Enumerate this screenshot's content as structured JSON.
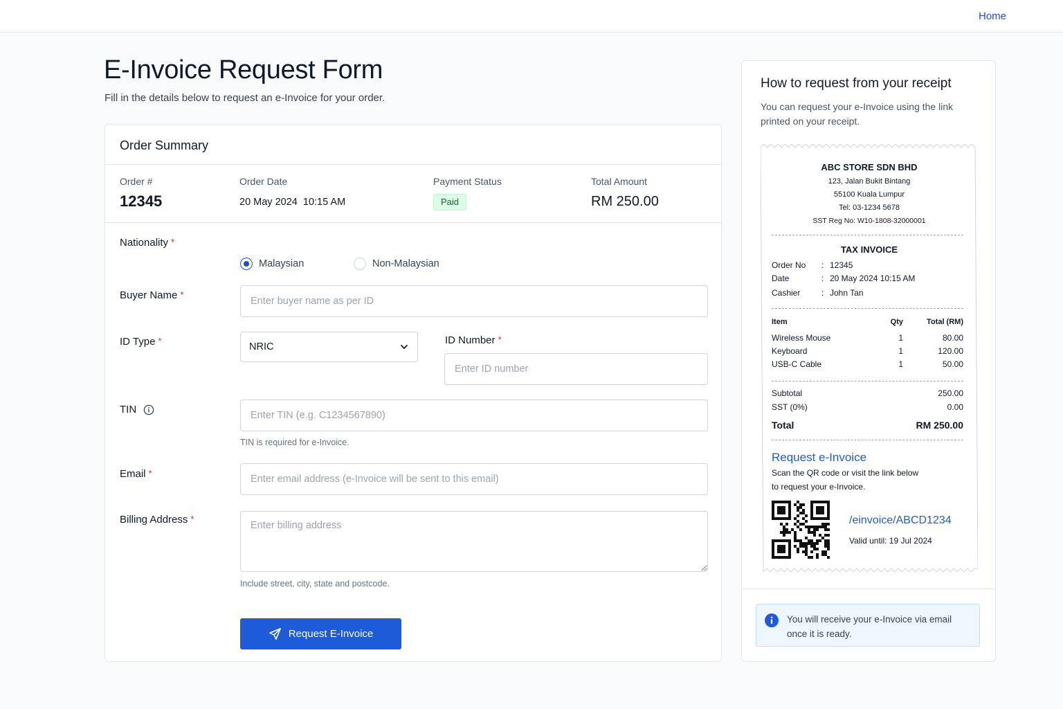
{
  "nav": {
    "home": "Home"
  },
  "page": {
    "title": "E-Invoice Request Form",
    "subtitle": "Fill in the details below to request an e-Invoice for your order."
  },
  "summary": {
    "title": "Order Summary",
    "order_label": "Order #",
    "order_value": "12345",
    "date_label": "Order Date",
    "date_value": "20 May 2024  10:15 AM",
    "status_label": "Payment Status",
    "status_value": "Paid",
    "total_label": "Total Amount",
    "total_value": "RM 250.00"
  },
  "form": {
    "nationality_label": "Nationality",
    "nationality_options": [
      "Malaysian",
      "Non-Malaysian"
    ],
    "nationality_selected": "Malaysian",
    "buyer_label": "Buyer Name",
    "buyer_placeholder": "Enter buyer name as per ID",
    "idtype_label": "ID Type",
    "idtype_value": "NRIC",
    "idnumber_label": "ID Number",
    "idnumber_placeholder": "Enter ID number",
    "tin_label": "TIN",
    "tin_placeholder": "Enter TIN (e.g. C1234567890)",
    "tin_hint": "TIN is required for e-Invoice.",
    "email_label": "Email",
    "email_placeholder": "Enter email address (e-Invoice will be sent to this email)",
    "address_label": "Billing Address",
    "address_placeholder": "Enter billing address",
    "address_hint": "Include street, city, state and postcode.",
    "required_mark": "*",
    "submit_label": "Request E-Invoice"
  },
  "help": {
    "title": "How to request from your receipt",
    "description": "You can request your e-Invoice using the link printed on your receipt.",
    "note": "You will receive your e-Invoice via email once it is ready."
  },
  "receipt": {
    "store": "ABC STORE SDN BHD",
    "address1": "123, Jalan Bukit Bintang",
    "address2": "55100 Kuala Lumpur",
    "tel": "Tel: 03-1234 5678",
    "sst": "SST Reg No: W10-1808-32000001",
    "doc_title": "TAX INVOICE",
    "meta": [
      {
        "label": "Order No",
        "sep": ":",
        "value": "12345"
      },
      {
        "label": "Date",
        "sep": ":",
        "value": "20 May 2024 10:15 AM"
      },
      {
        "label": "Cashier",
        "sep": ":",
        "value": "John Tan"
      }
    ],
    "col_item": "Item",
    "col_qty": "Qty",
    "col_total": "Total (RM)",
    "items": [
      {
        "name": "Wireless Mouse",
        "qty": "1",
        "total": "80.00"
      },
      {
        "name": "Keyboard",
        "qty": "1",
        "total": "120.00"
      },
      {
        "name": "USB-C Cable",
        "qty": "1",
        "total": "50.00"
      }
    ],
    "subtotal_label": "Subtotal",
    "subtotal_value": "250.00",
    "sst_label": "SST (0%)",
    "sst_value": "0.00",
    "total_label": "Total",
    "total_value": "RM 250.00",
    "request_title": "Request e-Invoice",
    "request_line1": "Scan the QR code or visit the link below",
    "request_line2": "to request your e-Invoice.",
    "link": "/einvoice/ABCD1234",
    "valid": "Valid until: 19 Jul 2024"
  },
  "colors": {
    "accent": "#1d5bd8",
    "link": "#1d4ed8",
    "required": "#dc2626",
    "paid_bg": "#dcfce7",
    "paid_text": "#166534"
  },
  "icons": {
    "tin_info": "info-circle-icon",
    "select": "chevron-down-icon",
    "submit": "send-icon",
    "note": "info-filled-icon",
    "receipt_code": "qr-code-icon"
  }
}
